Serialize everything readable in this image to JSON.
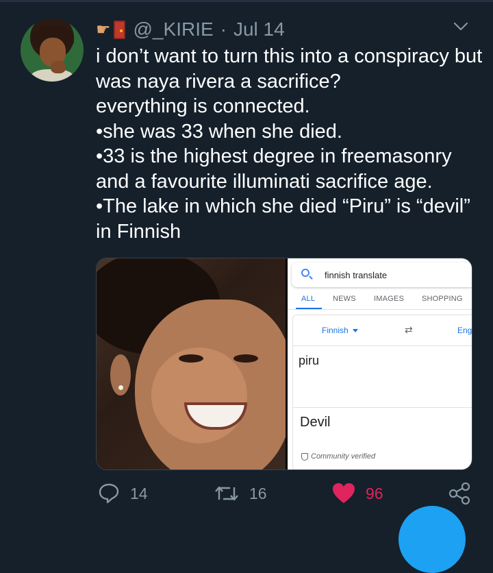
{
  "tweet": {
    "handle": "@_KIRIE",
    "separator": "·",
    "date": "Jul 14",
    "lines": [
      "i don’t want to turn this into a conspiracy but",
      "was naya rivera a sacrifice?",
      "everything is connected.",
      "•she was 33 when she died.",
      "•33 is the highest degree in freemasonry",
      "and a favourite illuminati sacrifice age.",
      "•The lake in which she died “Piru” is “devil”",
      "in Finnish"
    ]
  },
  "screenshot": {
    "query": "finnish translate",
    "tabs": [
      "ALL",
      "NEWS",
      "IMAGES",
      "SHOPPING"
    ],
    "active_tab": "ALL",
    "source_lang": "Finnish",
    "target_lang": "Eng",
    "source_text": "piru",
    "result_text": "Devil",
    "verified_label": "Community verified"
  },
  "actions": {
    "replies": "14",
    "retweets": "16",
    "likes": "96"
  },
  "icons": {
    "reply": "reply-icon",
    "retweet": "retweet-icon",
    "like": "heart-icon",
    "share": "share-icon",
    "more": "chevron-down-icon"
  },
  "colors": {
    "background": "#15202b",
    "muted": "#8899a6",
    "like": "#e0245e",
    "accent": "#1da1f2"
  }
}
